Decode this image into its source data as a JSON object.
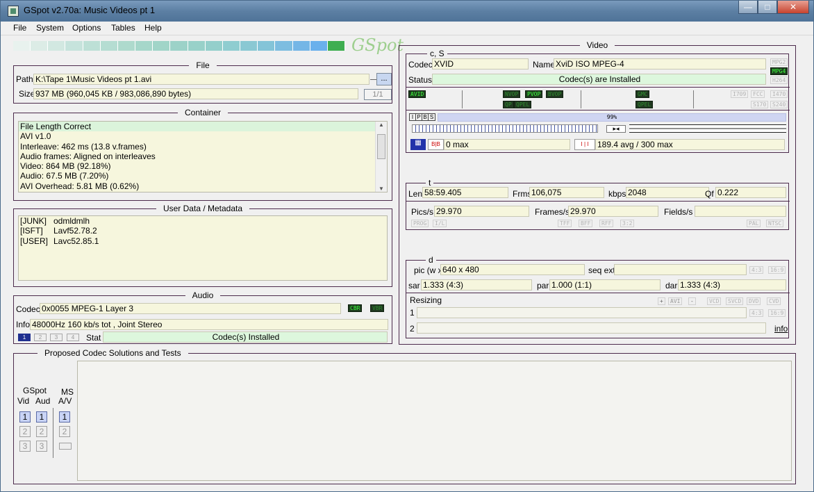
{
  "window": {
    "title": "GSpot v2.70a: Music Videos pt 1"
  },
  "menu": [
    "File",
    "System",
    "Options",
    "Tables",
    "Help"
  ],
  "logo_text": "GSpot",
  "file": {
    "section": "File",
    "path_label": "Path",
    "path_value": "K:\\Tape 1\\Music Videos pt 1.avi",
    "browse_label": "...",
    "size_label": "Size",
    "size_value": "937 MB (960,045 KB / 983,086,890 bytes)",
    "count": "1/1"
  },
  "container": {
    "section": "Container",
    "lines": [
      "File Length Correct",
      "AVI v1.0",
      "Interleave: 462 ms (13.8 v.frames)",
      "Audio frames: Aligned on interleaves",
      "Video: 864 MB (92.18%)",
      "Audio: 67.5 MB (7.20%)",
      "AVI Overhead: 5.81 MB (0.62%)"
    ]
  },
  "metadata": {
    "section": "User Data / Metadata",
    "rows": [
      {
        "key": "[JUNK]",
        "value": "odmldmlh"
      },
      {
        "key": "[ISFT]",
        "value": "Lavf52.78.2"
      },
      {
        "key": "[USER]",
        "value": "Lavc52.85.1"
      }
    ]
  },
  "audio": {
    "section": "Audio",
    "codec_label": "Codec",
    "codec_value": "0x0055  MPEG-1 Layer 3",
    "cbr": "CBR",
    "vbr": "VBR",
    "info_label": "Info",
    "info_value": "48000Hz  160 kb/s tot , Joint Stereo",
    "streams": [
      "1",
      "2",
      "3",
      "4"
    ],
    "stat_label": "Stat",
    "stat_value": "Codec(s) Installed"
  },
  "proposed": {
    "section": "Proposed Codec Solutions and Tests",
    "gspot": "GSpot",
    "vid": "Vid",
    "aud": "Aud",
    "ms": "MS",
    "av": "A/V",
    "buttons": [
      "1",
      "2",
      "3"
    ]
  },
  "video": {
    "section": "Video",
    "cs_title": "c, S",
    "codec_label": "Codec",
    "codec_value": "XVID",
    "name_label": "Name",
    "name_value": "XviD ISO MPEG-4",
    "status_label": "Status",
    "status_value": "Codec(s) are Installed",
    "flags_right": [
      "MPG2",
      "MPG4",
      "H264"
    ],
    "avid": "AVID",
    "flags_mid1": [
      "NVOP",
      "PVOP",
      "BVOP"
    ],
    "flags_mid2": [
      "QP",
      "QPEL"
    ],
    "flags_gmc": [
      "GMC",
      "QPEL"
    ],
    "flags_std1": [
      "I709",
      "FCC",
      "I470"
    ],
    "flags_std2": [
      "S170",
      "S240"
    ],
    "ipbs": [
      "I",
      "P",
      "B",
      "S"
    ],
    "percent": "99%",
    "bframes_labels": [
      "B",
      "B"
    ],
    "bframes_value": "0 max",
    "iframes_labels": [
      "I",
      "I"
    ],
    "iframes_value": "189.4 avg / 300 max",
    "t_title": "t",
    "len_label": "Len",
    "len_value": "58:59.405",
    "frms_label": "Frms",
    "frms_value": "106,075",
    "kbps_label": "kbps",
    "kbps_value": "2048",
    "qf_label": "Qf",
    "qf_value": "0.222",
    "pics_label": "Pics/s",
    "pics_value": "29.970",
    "frames_label": "Frames/s",
    "frames_value": "29.970",
    "fields_label": "Fields/s",
    "fields_value": "",
    "t_flags_left": [
      "PROG",
      "I/L"
    ],
    "t_flags_mid": [
      "TFF",
      "BFF",
      "RFF",
      "3:2"
    ],
    "t_flags_right": [
      "PAL",
      "NTSC"
    ],
    "d_title": "d",
    "pic_label": "pic (w x",
    "pic_value": "640 x 480",
    "seqext_label": "seq ext",
    "seqext_value": "",
    "ratio_flags": [
      "4:3",
      "16:9"
    ],
    "sar_label": "sar",
    "sar_value": "1.333 (4:3)",
    "par_label": "par",
    "par_value": "1.000 (1:1)",
    "dar_label": "dar",
    "dar_value": "1.333 (4:3)",
    "resizing_label": "Resizing",
    "resize_buttons": [
      "+",
      "AVI",
      "-",
      "VCD",
      "SVCD",
      "DVD",
      "CVD"
    ],
    "row1_label": "1",
    "row2_label": "2",
    "row1_flags": [
      "4:3",
      "16:9"
    ],
    "info_link": "info"
  }
}
